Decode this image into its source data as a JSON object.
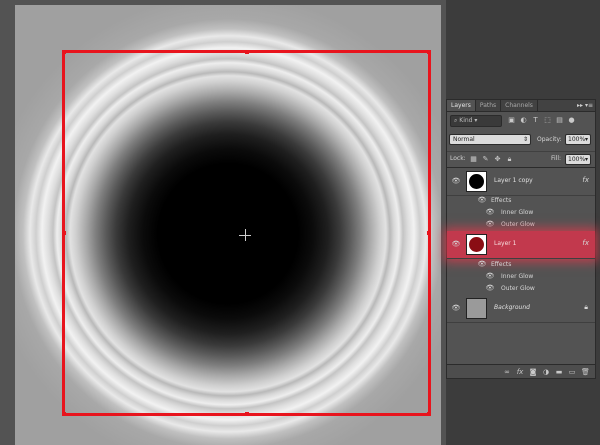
{
  "panel": {
    "tabs": [
      {
        "label": "Layers",
        "active": true
      },
      {
        "label": "Paths",
        "active": false
      },
      {
        "label": "Channels",
        "active": false
      }
    ],
    "tab_tools": "▸▸  ▾≡",
    "filter": {
      "kind_label": "Kind"
    },
    "blend_mode": "Normal",
    "opacity_label": "Opacity:",
    "opacity_value": "100%",
    "lock_label": "Lock:",
    "fill_label": "Fill:",
    "fill_value": "100%"
  },
  "layers": {
    "layer1_copy": {
      "name": "Layer 1 copy",
      "fx": "fx",
      "effects_label": "Effects",
      "inner_glow": "Inner Glow",
      "outer_glow": "Outer Glow"
    },
    "layer1": {
      "name": "Layer 1",
      "fx": "fx",
      "effects_label": "Effects",
      "inner_glow": "Inner Glow",
      "outer_glow": "Outer Glow"
    },
    "background": {
      "name": "Background"
    }
  },
  "colors": {
    "selection": "#e8141d",
    "selected_layer": "#c2394d",
    "panel_bg": "#535353"
  }
}
